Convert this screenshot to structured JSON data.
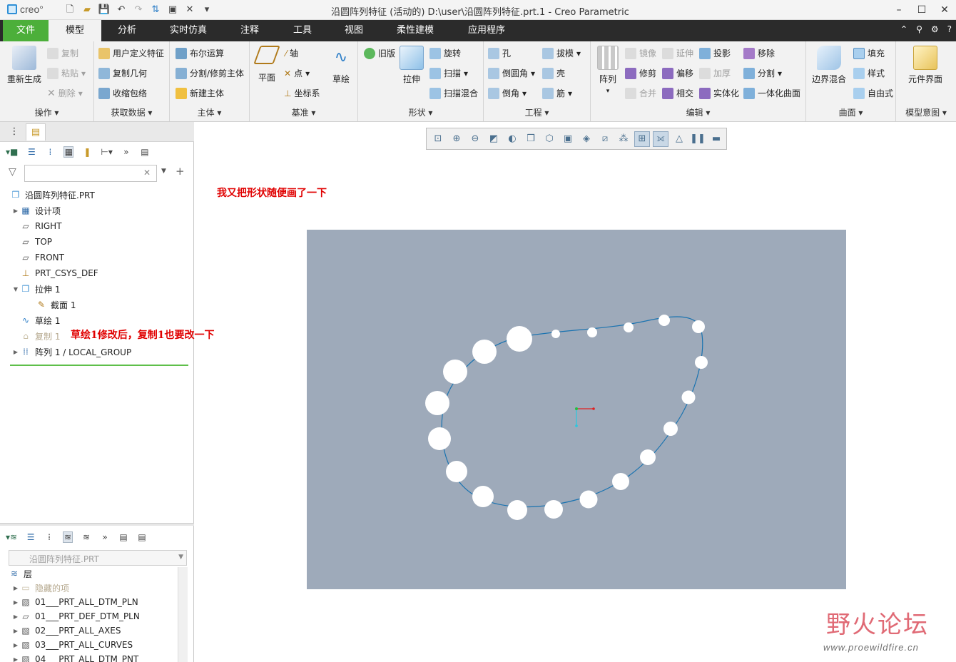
{
  "app": {
    "logo_text": "creo°",
    "window_title": "沿圆阵列特征 (活动的) D:\\user\\沿圆阵列特征.prt.1 - Creo Parametric"
  },
  "menu": {
    "tabs": [
      "文件",
      "模型",
      "分析",
      "实时仿真",
      "注释",
      "工具",
      "视图",
      "柔性建模",
      "应用程序"
    ],
    "active": "模型"
  },
  "ribbon": {
    "ops": {
      "regen": "重新生成",
      "copy": "复制",
      "paste": "粘贴",
      "delete": "删除",
      "label": "操作"
    },
    "getdata": {
      "udf": "用户定义特征",
      "copygeom": "复制几何",
      "shrinkwrap": "收缩包络",
      "label": "获取数据"
    },
    "body": {
      "boolean": "布尔运算",
      "split": "分割/修剪主体",
      "newbody": "新建主体",
      "label": "主体"
    },
    "datum": {
      "plane": "平面",
      "axis": "轴",
      "point": "点",
      "csys": "坐标系",
      "sketch": "草绘",
      "label": "基准"
    },
    "shape": {
      "legacy": "旧版",
      "extrude": "拉伸",
      "revolve": "旋转",
      "sweep": "扫描",
      "sweepblend": "扫描混合",
      "label": "形状"
    },
    "engineering": {
      "hole": "孔",
      "draft": "拔模",
      "round": "倒圆角",
      "shell": "壳",
      "chamfer": "倒角",
      "rib": "筋",
      "label": "工程"
    },
    "edit": {
      "pattern": "阵列",
      "mirror": "镜像",
      "extend": "延伸",
      "project": "投影",
      "trim": "修剪",
      "offset": "偏移",
      "thicken": "加厚",
      "merge": "合并",
      "intersect": "相交",
      "solidify": "实体化",
      "move": "移除",
      "splitsurf": "分割",
      "unify": "一体化曲面",
      "label": "编辑"
    },
    "surface": {
      "boundary": "边界混合",
      "fill": "填充",
      "style": "样式",
      "freestyle": "自由式",
      "label": "曲面"
    },
    "intent": {
      "component": "元件界面",
      "label": "模型意图"
    }
  },
  "tree": {
    "items": [
      {
        "label": "沿圆阵列特征.PRT",
        "icon": "part-icon"
      },
      {
        "label": "设计项",
        "icon": "design-items-icon"
      },
      {
        "label": "RIGHT",
        "icon": "datum-plane-icon"
      },
      {
        "label": "TOP",
        "icon": "datum-plane-icon"
      },
      {
        "label": "FRONT",
        "icon": "datum-plane-icon"
      },
      {
        "label": "PRT_CSYS_DEF",
        "icon": "csys-icon"
      },
      {
        "label": "拉伸 1",
        "icon": "extrude-icon"
      },
      {
        "label": "截面 1",
        "icon": "section-icon"
      },
      {
        "label": "草绘 1",
        "icon": "sketch-icon"
      },
      {
        "label": "复制 1",
        "icon": "copy-icon"
      },
      {
        "label": "阵列 1 / LOCAL_GROUP",
        "icon": "pattern-icon"
      }
    ]
  },
  "layers": {
    "combo": "沿圆阵列特征.PRT",
    "header": "层",
    "items": [
      "隐藏的项",
      "01___PRT_ALL_DTM_PLN",
      "01___PRT_DEF_DTM_PLN",
      "02___PRT_ALL_AXES",
      "03___PRT_ALL_CURVES",
      "04___PRT_ALL_DTM_PNT"
    ]
  },
  "annotations": {
    "top": "我又把形状随便画了一下",
    "tree_note": "草绘1修改后，复制1也要改一下"
  },
  "watermark": {
    "title": "野火论坛",
    "url": "www.proewildfire.cn"
  },
  "colors": {
    "viewport": "#9eaaba",
    "curve": "#1a73b0",
    "accent": "#4caf3a",
    "annotation": "#e00000"
  }
}
